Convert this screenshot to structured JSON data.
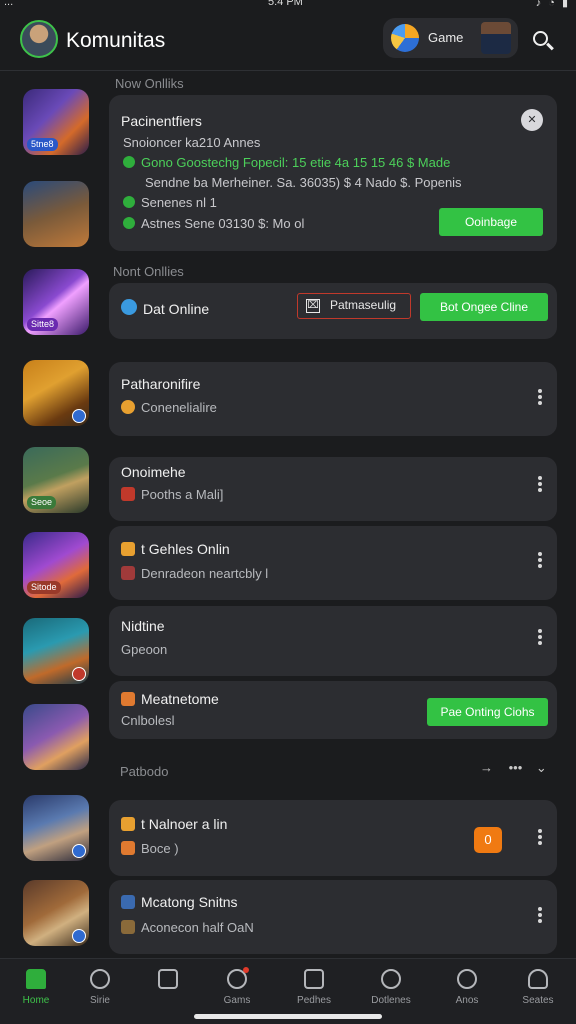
{
  "status_bar": {
    "left": "...",
    "time": "5:4 PM",
    "right": "♪ ◔ ▮"
  },
  "header": {
    "title": "Komunitas",
    "game_pill_label": "Game",
    "avatar_icon": "user-avatar",
    "search_icon": "search-icon"
  },
  "sections": {
    "first_label": "Now Onlliks",
    "second_label": "Nont Onllies",
    "third_label": "Patbodo"
  },
  "featured_card": {
    "title": "Pacinentfiers",
    "subtitle": "Snoioncer ka210 Annes",
    "lines": [
      "Gono Goostechg Fopecil: 15 etie  4a 15 15 46 $ Made",
      "Sendne ba Merheiner. Sa. 36035) $ 4 Nado $. Popenis",
      "Senenes nl 1",
      "Astnes Sene 03130 $: Mo ol"
    ],
    "button_label": "Ooinbage",
    "close_icon": "star-close-icon"
  },
  "online_row": {
    "label": "Dat Online",
    "outline_button": "Patmaseulig",
    "green_button": "Bot Ongee Cline"
  },
  "list_items": [
    {
      "title": "Patharonifire",
      "subtitle": "Conenelialire",
      "sub_icon_color": "#e8a030"
    },
    {
      "title": "Onoimehe",
      "subtitle": "Pooths a Mali]",
      "sub_icon_color": "#c0392b"
    },
    {
      "title": "t Gehles Onlin",
      "subtitle": "Denradeon neartcbly l",
      "sub_icon_color": "#a03a3a"
    },
    {
      "title": "Nidtine",
      "subtitle": "Gpeoon",
      "sub_icon_color": ""
    },
    {
      "title": "Meatnetome",
      "subtitle": "Cnlbolesl",
      "sub_icon_color": "",
      "button": "Pae Onting Ciohs"
    },
    {
      "title": "t Nalnoer a lin",
      "subtitle": "Boce )",
      "sub_icon_color": "#e07a30",
      "badge": "0"
    },
    {
      "title": "Mcatong Snitns",
      "subtitle": "Aconecon half OaN",
      "sub_icon_color": "#3a6ab0"
    }
  ],
  "thumb_badges": [
    "5tne8",
    "",
    "Sitte8",
    "",
    "Seoe",
    "Sitode",
    "",
    "",
    "",
    ""
  ],
  "bottom_nav": [
    {
      "label": "Home",
      "active": true
    },
    {
      "label": "Sirie",
      "active": false
    },
    {
      "label": "",
      "active": false
    },
    {
      "label": "Gams",
      "active": false,
      "dot": true
    },
    {
      "label": "Pedhes",
      "active": false
    },
    {
      "label": "Dotlenes",
      "active": false
    },
    {
      "label": "Anos",
      "active": false
    },
    {
      "label": "Seates",
      "active": false
    }
  ],
  "colors": {
    "accent_green": "#33c244",
    "background": "#1b1c1e",
    "card": "#2c2d31",
    "badge_orange": "#f07a12"
  }
}
